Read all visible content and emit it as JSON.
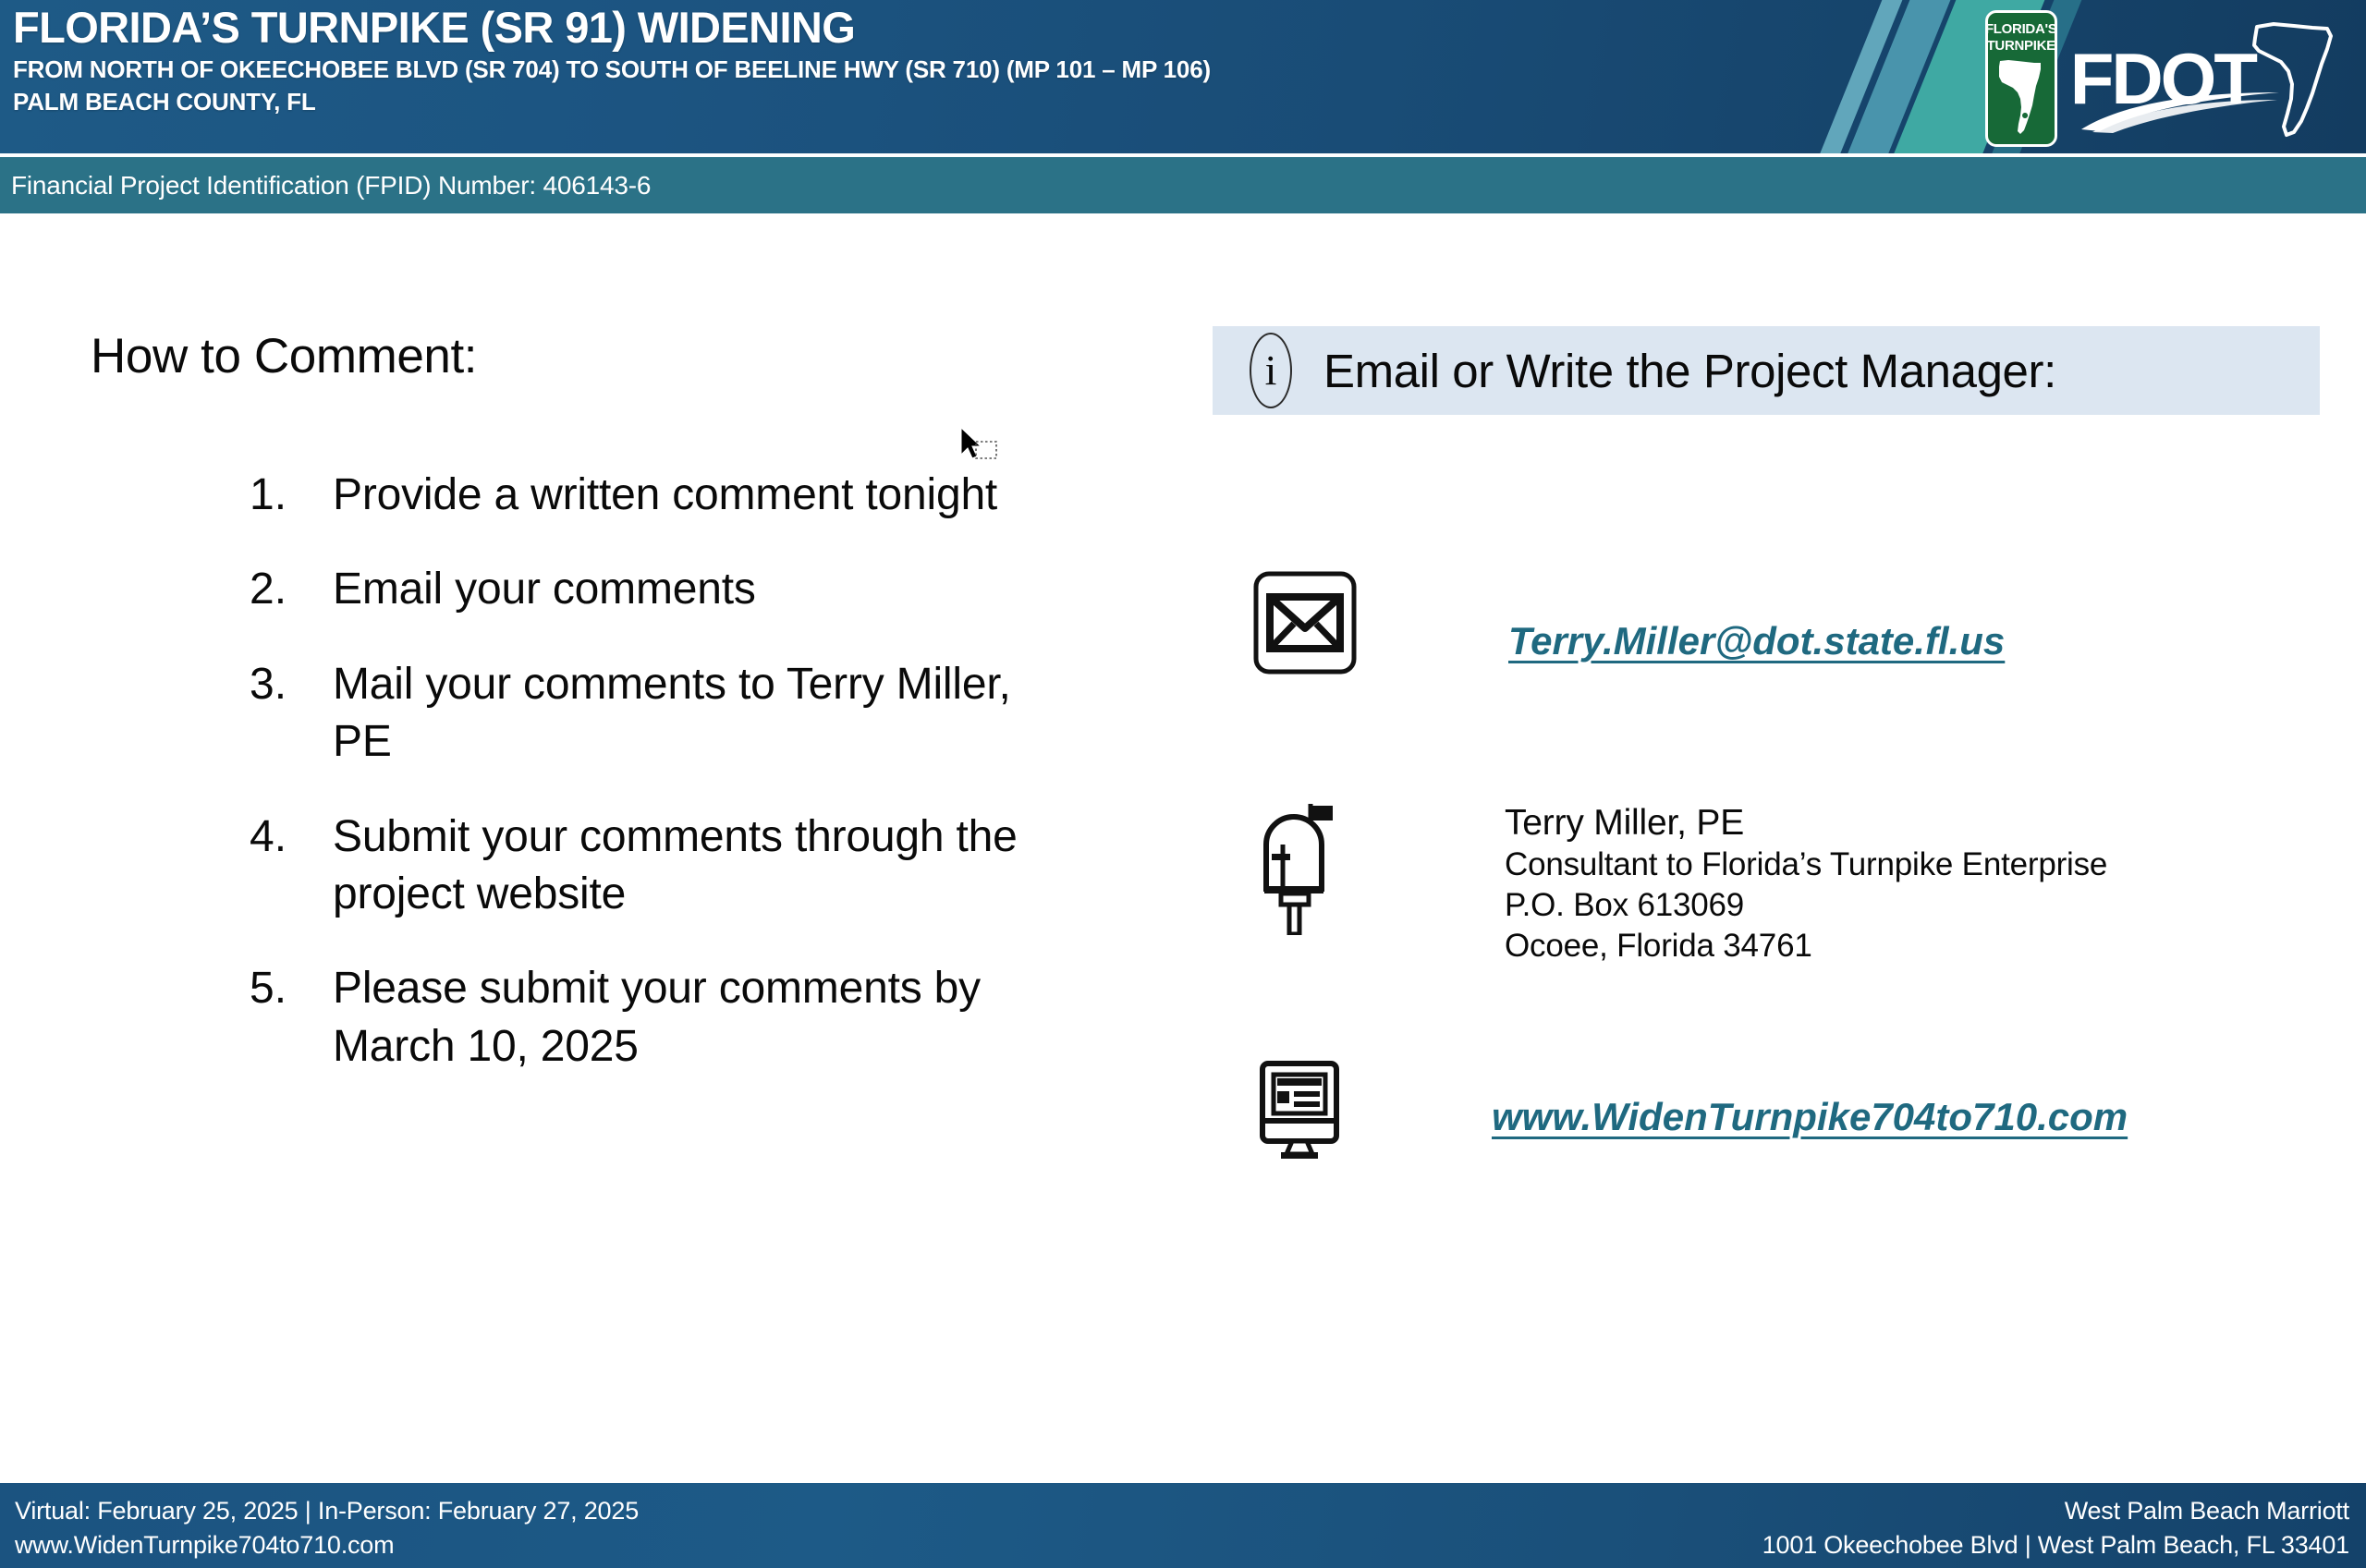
{
  "header": {
    "title": "FLORIDA’S TURNPIKE (SR 91) WIDENING",
    "subtitle_line1": "FROM NORTH OF OKEECHOBEE BLVD (SR 704) TO SOUTH OF BEELINE HWY (SR 710) (MP 101 – MP 106)",
    "subtitle_line2": "PALM BEACH COUNTY, FL",
    "logo": {
      "turnpike_line1": "FLORIDA'S",
      "turnpike_line2": "TURNPIKE",
      "agency_wordmark": "FDOT",
      "shield_color": "#176937",
      "header_blue": "#1b5280",
      "stripe_teal": "#3fa9a3"
    }
  },
  "fpid_bar": {
    "text": "Financial Project Identification (FPID) Number: 406143-6",
    "background": "#2b7287"
  },
  "main": {
    "how_to_comment_title": "How to Comment:",
    "steps": [
      {
        "number": "1.",
        "text": "Provide a written comment tonight"
      },
      {
        "number": "2.",
        "text": "Email your comments"
      },
      {
        "number": "3.",
        "text": "Mail your comments to Terry Miller, PE"
      },
      {
        "number": "4.",
        "text": "Submit your comments through the project website"
      },
      {
        "number": "5.",
        "text": "Please submit your comments by March 10, 2025"
      }
    ]
  },
  "project_manager": {
    "band_label": "Email or Write the Project Manager:",
    "band_background": "#dce6f1",
    "info_icon_glyph": "i",
    "link_color": "#1f6980",
    "email": "Terry.Miller@dot.state.fl.us",
    "mailing_address": {
      "name": "Terry Miller, PE",
      "line1": "Consultant to Florida’s Turnpike Enterprise",
      "line2": "P.O. Box 613069",
      "line3": "Ocoee, Florida 34761"
    },
    "website": "www.WidenTurnpike704to710.com"
  },
  "footer": {
    "left_line1": "Virtual: February 25, 2025 | In-Person: February 27, 2025",
    "left_line2": "www.WidenTurnpike704to710.com",
    "right_line1": "West Palm Beach Marriott",
    "right_line2": "1001 Okeechobee Blvd | West Palm Beach, FL 33401"
  }
}
